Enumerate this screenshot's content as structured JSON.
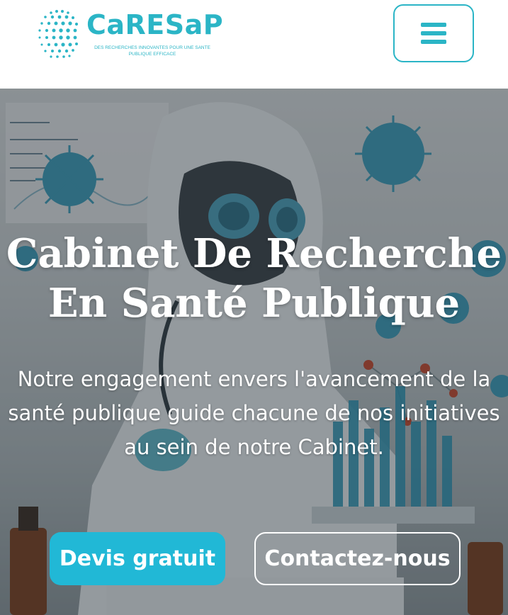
{
  "header": {
    "logo": {
      "name": "CaRESaP",
      "tagline": "DES RECHERCHES INNOVANTES POUR UNE SANTE PUBLIQUE EFFICACE",
      "icon": "dotted-globe-icon",
      "color": "#2bb5c6"
    },
    "menu_button": {
      "icon": "hamburger-menu-icon",
      "color": "#2bb5c6"
    }
  },
  "hero": {
    "title_line1": "Cabinet De Recherche",
    "title_line2": "En Santé Publique",
    "subtitle": "Notre engagement envers l'avancement de la santé publique guide chacune de nos initiatives au sein de notre Cabinet.",
    "cta_primary": "Devis gratuit",
    "cta_secondary": "Contactez-nous",
    "accent_color": "#21b8d6"
  }
}
